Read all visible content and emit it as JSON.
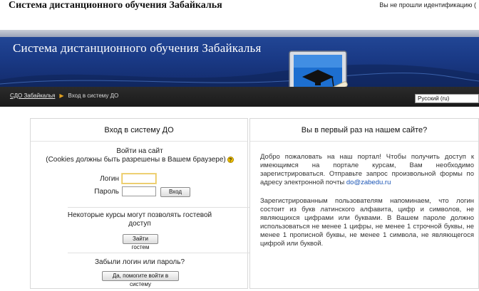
{
  "header": {
    "site_title": "Система дистанционного обучения Забайкалья",
    "login_status": "Вы не прошли идентификацию (",
    "banner_title": "Система дистанционного обучения Забайкалья"
  },
  "navbar": {
    "breadcrumb": [
      "СДО Забайкалья",
      "Вход в систему ДО"
    ],
    "language": "Русский (ru)"
  },
  "login_panel": {
    "heading": "Вход в систему ДО",
    "intro_line1": "Войти на сайт",
    "intro_line2": "(Cookies должны быть разрешены в Вашем браузере)",
    "username_label": "Логин",
    "username_value": "",
    "password_label": "Пароль",
    "password_value": "",
    "login_button": "Вход",
    "guest_text_line1": "Некоторые курсы могут позволять гостевой",
    "guest_text_line2": "доступ",
    "guest_button": "Зайти гостем",
    "forgot_text": "Забыли логин или пароль?",
    "forgot_button": "Да, помогите войти в систему"
  },
  "signup_panel": {
    "heading": "Вы в первый раз на нашем сайте?",
    "para1": "Добро пожаловать на наш портал! Чтобы получить доступ к имеющимся на портале курсам, Вам необходимо зарегистрироваться. Отправьте запрос произвольной формы по адресу электронной почты",
    "email": "do@zabedu.ru",
    "para2": "Зарегистрированным пользователям напоминаем, что логин состоит из букв латинского алфавита, цифр и символов, не являющихся цифрами или буквами. В Вашем пароле должно использоваться не менее 1 цифры, не менее 1 строчной буквы, не менее 1 прописной буквы, не менее 1 символа, не являющегося цифрой или буквой."
  },
  "colors": {
    "banner": "#1a3a86",
    "navbar": "#1a1a1a",
    "breadcrumb_separator": "#e0a020",
    "link": "#1a55b5"
  }
}
